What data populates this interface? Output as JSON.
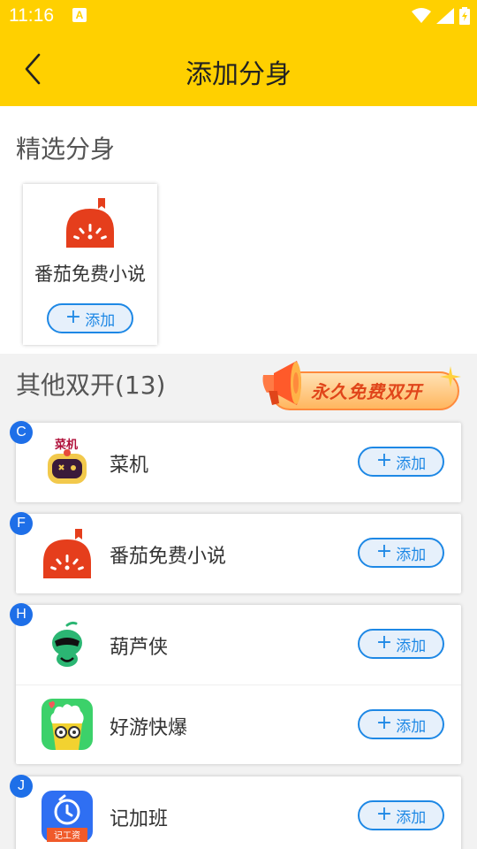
{
  "status_bar": {
    "time": "11:16",
    "notif_icon_letter": "A"
  },
  "header": {
    "title": "添加分身"
  },
  "featured": {
    "title": "精选分身",
    "items": [
      {
        "name": "番茄免费小说",
        "icon": "tomato-novel-icon",
        "add_label": "添加"
      }
    ]
  },
  "others": {
    "title": "其他双开(13)",
    "promo_text": "永久免费双开",
    "groups": [
      {
        "letter": "C",
        "items": [
          {
            "name": "菜机",
            "icon": "caiji-icon",
            "add_label": "添加"
          }
        ]
      },
      {
        "letter": "F",
        "items": [
          {
            "name": "番茄免费小说",
            "icon": "tomato-novel-icon",
            "add_label": "添加"
          }
        ]
      },
      {
        "letter": "H",
        "items": [
          {
            "name": "葫芦侠",
            "icon": "huluxia-icon",
            "add_label": "添加"
          },
          {
            "name": "好游快爆",
            "icon": "haoyou-kuaibao-icon",
            "add_label": "添加"
          }
        ]
      },
      {
        "letter": "J",
        "items": [
          {
            "name": "记加班",
            "icon": "jijiaban-icon",
            "add_label": "添加"
          }
        ]
      }
    ]
  },
  "colors": {
    "header": "#FFD000",
    "accent": "#1E88E5",
    "badge": "#1E6FE8"
  }
}
